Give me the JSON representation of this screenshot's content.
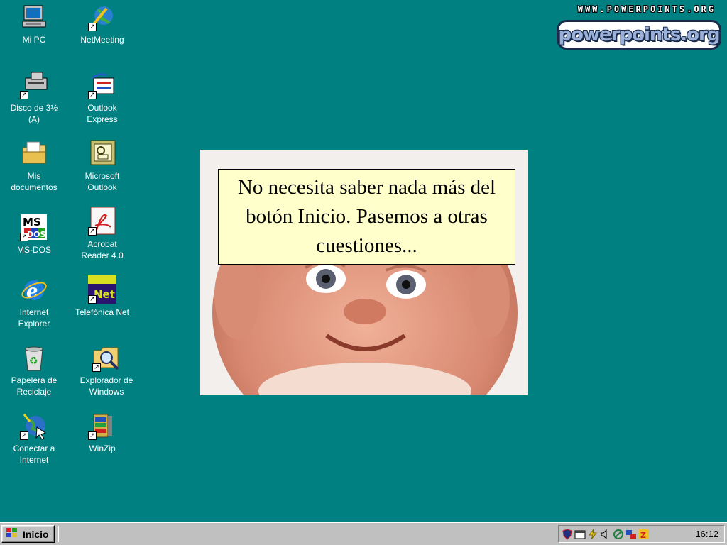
{
  "brand": {
    "url": "WWW.POWERPOINTS.ORG",
    "logo": "powerpoints.org"
  },
  "desktop_icons": [
    {
      "label": "Mi PC",
      "icon": "my-computer-icon"
    },
    {
      "label": "NetMeeting",
      "icon": "netmeeting-icon"
    },
    {
      "label": "Disco de 3½\n(A)",
      "icon": "floppy-drive-icon"
    },
    {
      "label": "Outlook\nExpress",
      "icon": "outlook-express-icon"
    },
    {
      "label": "Mis\ndocumentos",
      "icon": "my-documents-folder-icon"
    },
    {
      "label": "Microsoft\nOutlook",
      "icon": "microsoft-outlook-icon"
    },
    {
      "label": "MS-DOS",
      "icon": "ms-dos-icon"
    },
    {
      "label": "Acrobat\nReader 4.0",
      "icon": "acrobat-reader-icon"
    },
    {
      "label": "Internet\nExplorer",
      "icon": "internet-explorer-icon"
    },
    {
      "label": "Telefónica Net",
      "icon": "telefonica-net-icon"
    },
    {
      "label": "Papelera de\nReciclaje",
      "icon": "recycle-bin-icon"
    },
    {
      "label": "Explorador de\nWindows",
      "icon": "windows-explorer-icon"
    },
    {
      "label": "Conectar a\nInternet",
      "icon": "connect-internet-icon"
    },
    {
      "label": "WinZip",
      "icon": "winzip-icon"
    }
  ],
  "callout": {
    "text": "No necesita saber nada más del botón Inicio. Pasemos a otras cuestiones..."
  },
  "taskbar": {
    "start_label": "Inicio",
    "clock": "16:12",
    "tray_icons": [
      "antivirus-shield-icon",
      "scheduler-icon",
      "power-icon",
      "volume-icon",
      "network-icon",
      "connection-icon",
      "zonealarm-icon"
    ]
  },
  "colors": {
    "desktop": "#008080",
    "taskbar": "#c0c0c0",
    "callout": "#ffffcc"
  }
}
